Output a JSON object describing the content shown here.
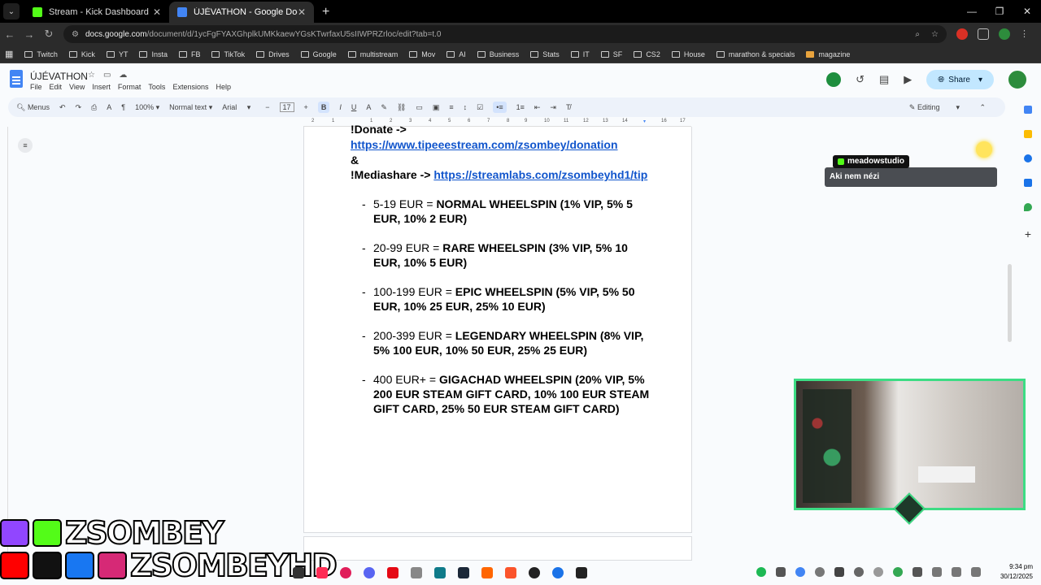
{
  "browser": {
    "tabs": [
      {
        "title": "Stream - Kick Dashboard",
        "active": false,
        "favicon_color": "#53fc18"
      },
      {
        "title": "ÚJÉVATHON - Google Docs",
        "active": true,
        "favicon_color": "#4285f4"
      }
    ],
    "url_host": "docs.google.com",
    "url_path": "/document/d/1ycFgFYAXGhplkUMKkaewYGsKTwrfaxU5sIIWPRZrloc/edit?tab=t.0",
    "bookmarks": [
      "Twitch",
      "Kick",
      "YT",
      "Insta",
      "FB",
      "TikTok",
      "Drives",
      "Google",
      "multistream",
      "Mov",
      "AI",
      "Business",
      "Stats",
      "IT",
      "SF",
      "CS2",
      "House",
      "marathon & specials",
      "magazine"
    ]
  },
  "docs": {
    "title": "ÚJÉVATHON",
    "menu": [
      "File",
      "Edit",
      "View",
      "Insert",
      "Format",
      "Tools",
      "Extensions",
      "Help"
    ],
    "share_label": "Share",
    "toolbar": {
      "menus": "Menus",
      "zoom": "100%",
      "style": "Normal text",
      "font": "Arial",
      "size": "17",
      "mode": "Editing"
    },
    "ruler_ticks": [
      "2",
      "1",
      "1",
      "2",
      "3",
      "4",
      "5",
      "6",
      "7",
      "8",
      "9",
      "10",
      "11",
      "12",
      "13",
      "14",
      "15",
      "16",
      "17",
      "18"
    ]
  },
  "document": {
    "donate_label": "!Donate ->",
    "donate_link": "https://www.tipeeestream.com/zsombey/donation",
    "amp": "&",
    "mediashare_label": "!Mediashare ->",
    "mediashare_link": "https://streamlabs.com/zsombeyhd1/tip",
    "items": [
      {
        "dash": "-",
        "amount": "5-19 EUR = ",
        "reward": "NORMAL WHEELSPIN (1% VIP, 5% 5 EUR, 10% 2 EUR)"
      },
      {
        "dash": "-",
        "amount": "20-99 EUR = ",
        "reward": "RARE WHEELSPIN (3% VIP, 5% 10 EUR, 10% 5 EUR)"
      },
      {
        "dash": "-",
        "amount": "100-199 EUR = ",
        "reward": "EPIC WHEELSPIN (5% VIP, 5% 50 EUR, 10% 25 EUR, 25% 10 EUR)"
      },
      {
        "dash": "-",
        "amount": "200-399 EUR = ",
        "reward": "LEGENDARY WHEELSPIN (8% VIP, 5% 100 EUR, 10% 50 EUR, 25% 25 EUR)"
      },
      {
        "dash": "-",
        "amount": "400 EUR+ = ",
        "reward": "GIGACHAD WHEELSPIN (20% VIP, 5% 200 EUR STEAM GIFT CARD, 10% 100 EUR STEAM GIFT CARD, 25% 50 EUR STEAM GIFT CARD)"
      }
    ]
  },
  "overlay": {
    "chat_user": "meadowstudio",
    "chat_message": "Aki nem nézi",
    "brand_line1": "ZSOMBEY",
    "brand_line2": "ZSOMBEYHD"
  },
  "system": {
    "time": "9:34 pm",
    "date": "30/12/2025"
  },
  "colors": {
    "kick_green": "#53fc18",
    "docs_blue": "#4285f4",
    "link_blue": "#1155cc",
    "cam_border": "#3ddc84"
  }
}
